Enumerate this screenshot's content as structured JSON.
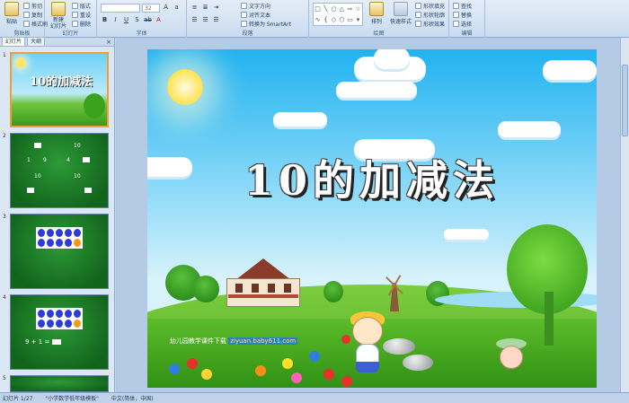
{
  "ribbon": {
    "clipboard": {
      "paste": "粘贴",
      "cut": "剪切",
      "copy": "复制",
      "format_painter": "格式刷",
      "label": "剪贴板"
    },
    "slides": {
      "new_slide": "新建\n幻灯片",
      "layout": "版式",
      "reset": "重设",
      "delete": "删除",
      "label": "幻灯片"
    },
    "font": {
      "name": "",
      "size": "32",
      "label": "字体"
    },
    "paragraph": {
      "text_direction": "文字方向",
      "align_text": "对齐文本",
      "smartart": "转换为 SmartArt",
      "label": "段落"
    },
    "drawing": {
      "arrange": "排列",
      "quick_styles": "快速样式",
      "fill": "形状填充",
      "outline": "形状轮廓",
      "effects": "形状效果",
      "label": "绘图"
    },
    "editing": {
      "find": "查找",
      "replace": "替换",
      "select": "选择",
      "label": "编辑"
    }
  },
  "pane": {
    "tabs": [
      "幻灯片",
      "大纲"
    ],
    "close": "×",
    "slide_numbers": [
      "1",
      "2",
      "3",
      "4",
      "5"
    ],
    "thumb1_title": "10的加减法",
    "thumb2_labels": {
      "a": "10",
      "b": "1",
      "c": "9",
      "d": "10",
      "e": "4",
      "f": "10",
      "g": "10"
    },
    "thumb4_eq": "9 + 1 ="
  },
  "slide": {
    "title": "10的加减法",
    "banner_text": "幼儿园教学课件下载",
    "banner_url": "ziyuan.baby611.com"
  },
  "status": {
    "slide_counter": "幻灯片 1/27",
    "theme": "\"小学数学低年级模板\"",
    "language": "中文(简体，中国)"
  },
  "colors": {
    "sky": "#21b2f0",
    "grass": "#4aa41f",
    "thumb_green": "#12641c",
    "selection": "#f0a030"
  }
}
